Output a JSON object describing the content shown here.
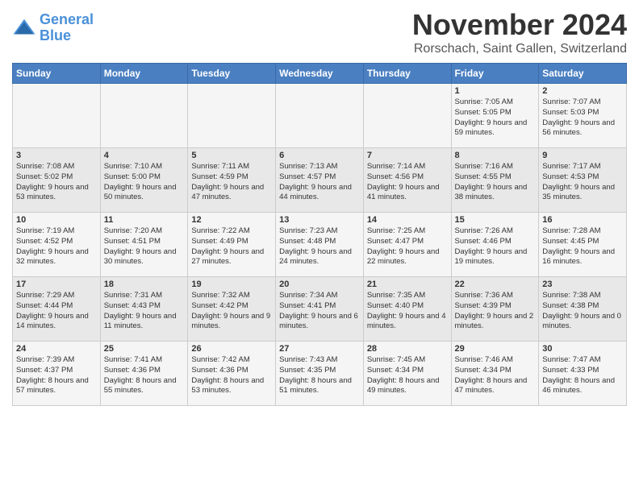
{
  "header": {
    "logo_line1": "General",
    "logo_line2": "Blue",
    "month": "November 2024",
    "location": "Rorschach, Saint Gallen, Switzerland"
  },
  "weekdays": [
    "Sunday",
    "Monday",
    "Tuesday",
    "Wednesday",
    "Thursday",
    "Friday",
    "Saturday"
  ],
  "weeks": [
    [
      {
        "day": "",
        "info": ""
      },
      {
        "day": "",
        "info": ""
      },
      {
        "day": "",
        "info": ""
      },
      {
        "day": "",
        "info": ""
      },
      {
        "day": "",
        "info": ""
      },
      {
        "day": "1",
        "info": "Sunrise: 7:05 AM\nSunset: 5:05 PM\nDaylight: 9 hours and 59 minutes."
      },
      {
        "day": "2",
        "info": "Sunrise: 7:07 AM\nSunset: 5:03 PM\nDaylight: 9 hours and 56 minutes."
      }
    ],
    [
      {
        "day": "3",
        "info": "Sunrise: 7:08 AM\nSunset: 5:02 PM\nDaylight: 9 hours and 53 minutes."
      },
      {
        "day": "4",
        "info": "Sunrise: 7:10 AM\nSunset: 5:00 PM\nDaylight: 9 hours and 50 minutes."
      },
      {
        "day": "5",
        "info": "Sunrise: 7:11 AM\nSunset: 4:59 PM\nDaylight: 9 hours and 47 minutes."
      },
      {
        "day": "6",
        "info": "Sunrise: 7:13 AM\nSunset: 4:57 PM\nDaylight: 9 hours and 44 minutes."
      },
      {
        "day": "7",
        "info": "Sunrise: 7:14 AM\nSunset: 4:56 PM\nDaylight: 9 hours and 41 minutes."
      },
      {
        "day": "8",
        "info": "Sunrise: 7:16 AM\nSunset: 4:55 PM\nDaylight: 9 hours and 38 minutes."
      },
      {
        "day": "9",
        "info": "Sunrise: 7:17 AM\nSunset: 4:53 PM\nDaylight: 9 hours and 35 minutes."
      }
    ],
    [
      {
        "day": "10",
        "info": "Sunrise: 7:19 AM\nSunset: 4:52 PM\nDaylight: 9 hours and 32 minutes."
      },
      {
        "day": "11",
        "info": "Sunrise: 7:20 AM\nSunset: 4:51 PM\nDaylight: 9 hours and 30 minutes."
      },
      {
        "day": "12",
        "info": "Sunrise: 7:22 AM\nSunset: 4:49 PM\nDaylight: 9 hours and 27 minutes."
      },
      {
        "day": "13",
        "info": "Sunrise: 7:23 AM\nSunset: 4:48 PM\nDaylight: 9 hours and 24 minutes."
      },
      {
        "day": "14",
        "info": "Sunrise: 7:25 AM\nSunset: 4:47 PM\nDaylight: 9 hours and 22 minutes."
      },
      {
        "day": "15",
        "info": "Sunrise: 7:26 AM\nSunset: 4:46 PM\nDaylight: 9 hours and 19 minutes."
      },
      {
        "day": "16",
        "info": "Sunrise: 7:28 AM\nSunset: 4:45 PM\nDaylight: 9 hours and 16 minutes."
      }
    ],
    [
      {
        "day": "17",
        "info": "Sunrise: 7:29 AM\nSunset: 4:44 PM\nDaylight: 9 hours and 14 minutes."
      },
      {
        "day": "18",
        "info": "Sunrise: 7:31 AM\nSunset: 4:43 PM\nDaylight: 9 hours and 11 minutes."
      },
      {
        "day": "19",
        "info": "Sunrise: 7:32 AM\nSunset: 4:42 PM\nDaylight: 9 hours and 9 minutes."
      },
      {
        "day": "20",
        "info": "Sunrise: 7:34 AM\nSunset: 4:41 PM\nDaylight: 9 hours and 6 minutes."
      },
      {
        "day": "21",
        "info": "Sunrise: 7:35 AM\nSunset: 4:40 PM\nDaylight: 9 hours and 4 minutes."
      },
      {
        "day": "22",
        "info": "Sunrise: 7:36 AM\nSunset: 4:39 PM\nDaylight: 9 hours and 2 minutes."
      },
      {
        "day": "23",
        "info": "Sunrise: 7:38 AM\nSunset: 4:38 PM\nDaylight: 9 hours and 0 minutes."
      }
    ],
    [
      {
        "day": "24",
        "info": "Sunrise: 7:39 AM\nSunset: 4:37 PM\nDaylight: 8 hours and 57 minutes."
      },
      {
        "day": "25",
        "info": "Sunrise: 7:41 AM\nSunset: 4:36 PM\nDaylight: 8 hours and 55 minutes."
      },
      {
        "day": "26",
        "info": "Sunrise: 7:42 AM\nSunset: 4:36 PM\nDaylight: 8 hours and 53 minutes."
      },
      {
        "day": "27",
        "info": "Sunrise: 7:43 AM\nSunset: 4:35 PM\nDaylight: 8 hours and 51 minutes."
      },
      {
        "day": "28",
        "info": "Sunrise: 7:45 AM\nSunset: 4:34 PM\nDaylight: 8 hours and 49 minutes."
      },
      {
        "day": "29",
        "info": "Sunrise: 7:46 AM\nSunset: 4:34 PM\nDaylight: 8 hours and 47 minutes."
      },
      {
        "day": "30",
        "info": "Sunrise: 7:47 AM\nSunset: 4:33 PM\nDaylight: 8 hours and 46 minutes."
      }
    ]
  ]
}
